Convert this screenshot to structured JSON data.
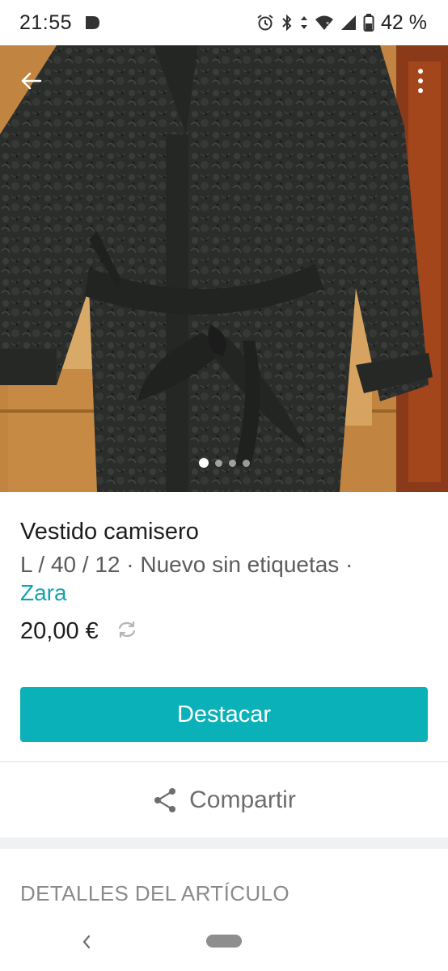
{
  "status_bar": {
    "time": "21:55",
    "battery_text": "42 %",
    "icons": [
      "notification-icon",
      "alarm-icon",
      "bluetooth-icon",
      "data-arrows-icon",
      "wifi-icon",
      "signal-icon",
      "battery-icon"
    ]
  },
  "gallery": {
    "image_count": 4,
    "active_index": 0,
    "icons": [
      "back-arrow-icon",
      "more-vert-icon"
    ]
  },
  "item": {
    "title": "Vestido camisero",
    "meta": "L / 40 / 12 · Nuevo sin etiquetas ·",
    "brand": "Zara",
    "price": "20,00 €",
    "price_icon": "swap-icon"
  },
  "actions": {
    "primary_label": "Destacar",
    "share_label": "Compartir",
    "share_icon": "share-icon"
  },
  "details": {
    "section_title": "DETALLES DEL ARTÍCULO"
  },
  "colors": {
    "accent": "#0bb1b8",
    "brand_link": "#14a4b0"
  }
}
